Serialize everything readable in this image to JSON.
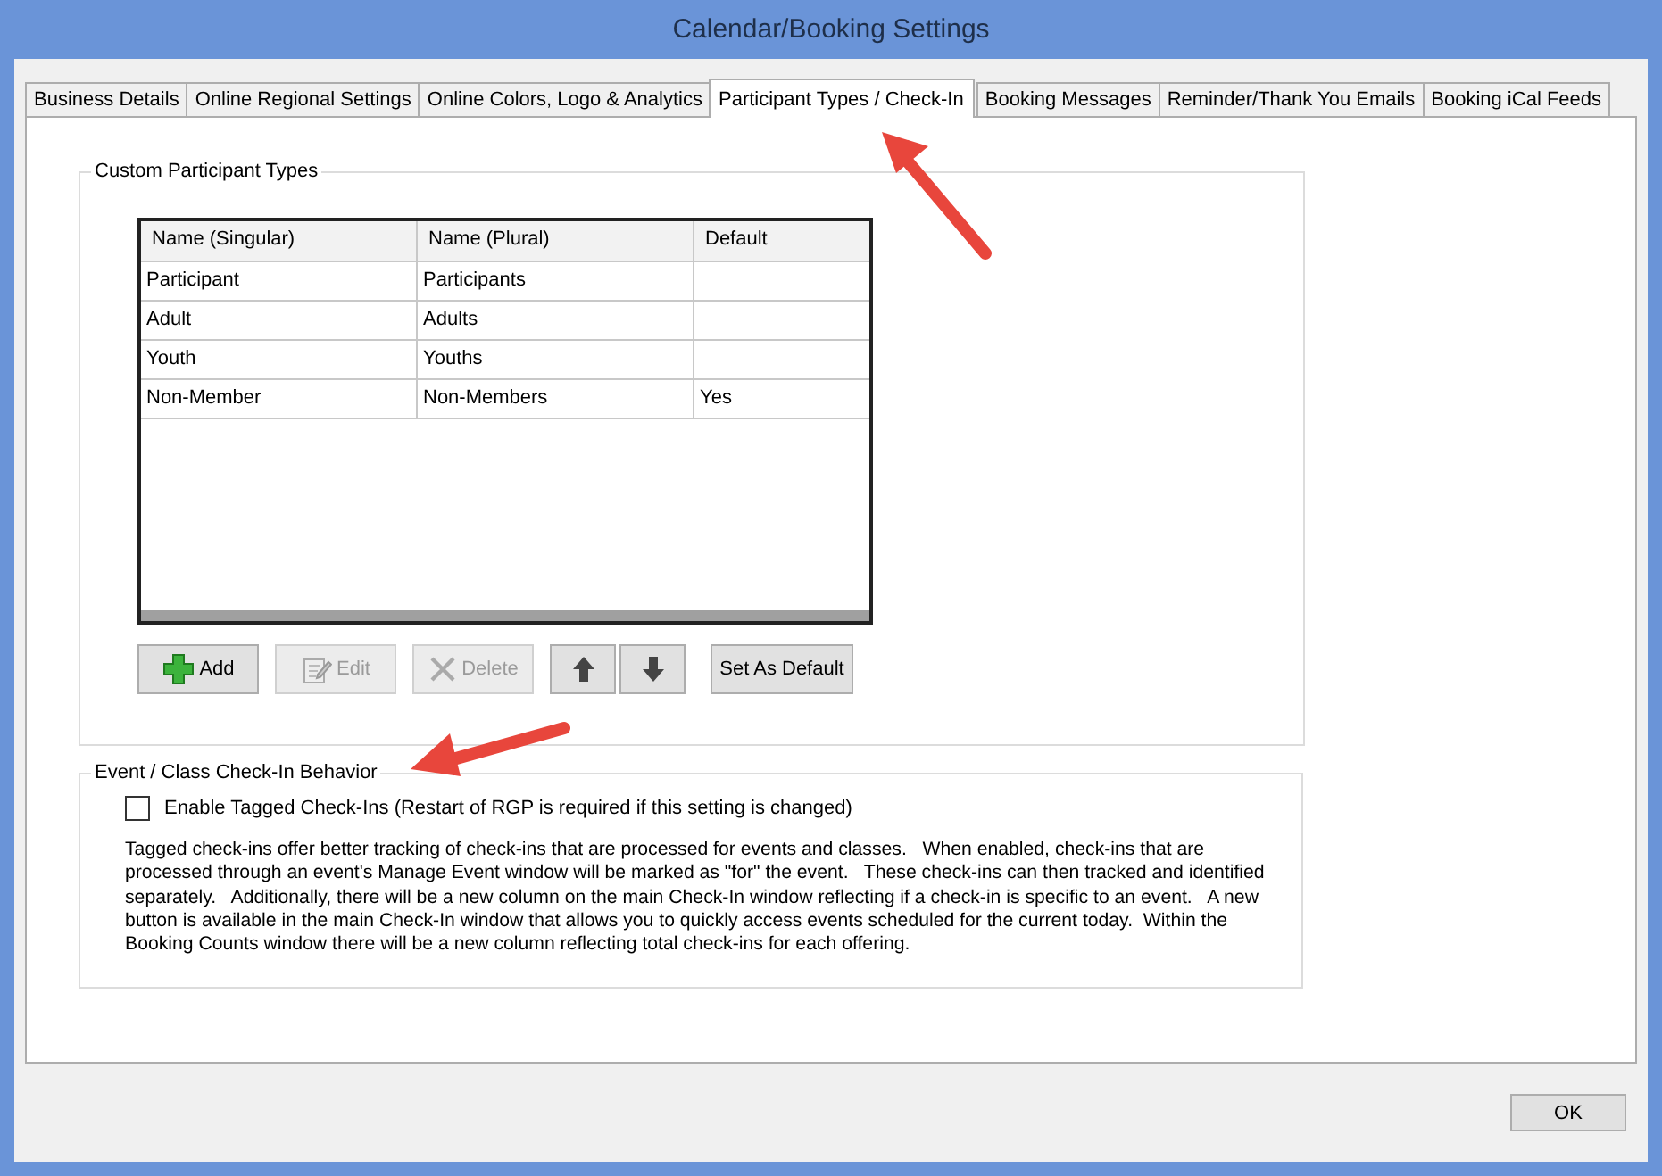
{
  "window": {
    "title": "Calendar/Booking Settings"
  },
  "tabs": [
    {
      "label": "Business Details",
      "selected": false
    },
    {
      "label": "Online Regional Settings",
      "selected": false
    },
    {
      "label": "Online Colors, Logo & Analytics",
      "selected": false
    },
    {
      "label": "Participant Types / Check-In",
      "selected": true
    },
    {
      "label": "Booking Messages",
      "selected": false
    },
    {
      "label": "Reminder/Thank You Emails",
      "selected": false
    },
    {
      "label": "Booking iCal Feeds",
      "selected": false
    }
  ],
  "participant_types": {
    "title": "Custom Participant Types",
    "columns": [
      "Name (Singular)",
      "Name (Plural)",
      "Default"
    ],
    "rows": [
      [
        "Participant",
        "Participants",
        ""
      ],
      [
        "Adult",
        "Adults",
        ""
      ],
      [
        "Youth",
        "Youths",
        ""
      ],
      [
        "Non-Member",
        "Non-Members",
        "Yes"
      ]
    ],
    "buttons": [
      {
        "kind": "add",
        "label": "Add",
        "disabled": false
      },
      {
        "kind": "edit",
        "label": "Edit",
        "disabled": true
      },
      {
        "kind": "delete",
        "label": "Delete",
        "disabled": true
      },
      {
        "kind": "up",
        "disabled": false
      },
      {
        "kind": "down",
        "disabled": false
      },
      {
        "kind": "default",
        "label": "Set As Default",
        "disabled": false
      }
    ]
  },
  "check_in": {
    "title": "Event / Class Check-In Behavior",
    "checkbox": {
      "label": "Enable Tagged Check-Ins (Restart of RGP is required if this setting is changed)",
      "checked": false
    },
    "description": "Tagged check-ins offer better tracking of check-ins that are processed for events and classes.   When enabled, check-ins that are processed through an event's Manage Event window will be marked as \"for\" the event.   These check-ins can then tracked and identified separately.   Additionally, there will be a new column on the main Check-In window reflecting if a check-in is specific to an event.   A new button is available in the main Check-In window that allows you to quickly access events scheduled for the current today.  Within the Booking Counts window there will be a new column reflecting total check-ins for each offering."
  },
  "footer": {
    "ok": "OK"
  }
}
